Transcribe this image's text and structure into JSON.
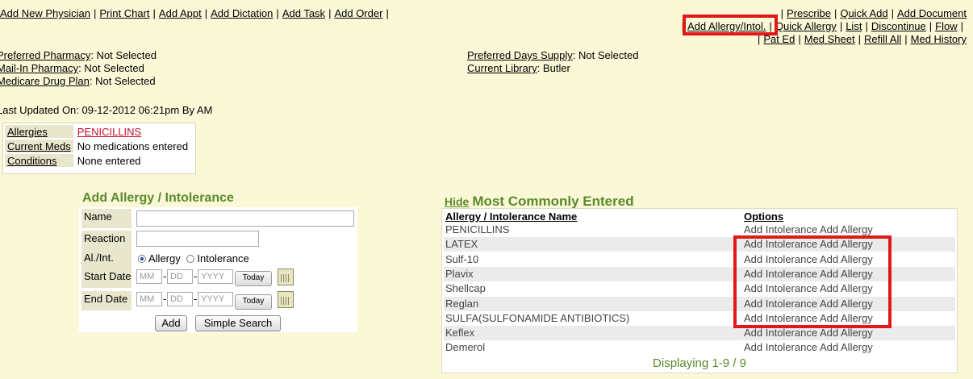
{
  "top_links_left": [
    "Add New Physician",
    "Print Chart",
    "Add Appt",
    "Add Dictation",
    "Add Task",
    "Add Order"
  ],
  "top_links_right": {
    "row1": [
      "Prescribe",
      "Quick Add",
      "Add Document"
    ],
    "row2": [
      "Add Allergy/Intol.",
      "Quick Allergy",
      "List",
      "Discontinue",
      "Flow"
    ],
    "row3": [
      "Pat Ed",
      "Med Sheet",
      "Refill All",
      "Med History"
    ]
  },
  "info": {
    "preferred_pharmacy": {
      "label": "Preferred Pharmacy",
      "value": ": Not Selected"
    },
    "mail_in_pharmacy": {
      "label": "Mail-In Pharmacy",
      "value": ": Not Selected"
    },
    "medicare_drug_plan": {
      "label": "Medicare Drug Plan",
      "value": ": Not Selected"
    },
    "preferred_days_supply": {
      "label": "Preferred Days Supply",
      "value": ": Not Selected"
    },
    "current_library": {
      "label": "Current Library",
      "value": ": Butler"
    },
    "last_updated": "Last Updated On: 09-12-2012 06:21pm By AM"
  },
  "summary": {
    "allergies_label": "Allergies",
    "allergies_value": "PENICILLINS",
    "meds_label": "Current Meds",
    "meds_value": "No medications entered",
    "conditions_label": "Conditions",
    "conditions_value": "None entered"
  },
  "add_form": {
    "title": "Add Allergy / Intolerance",
    "name_label": "Name",
    "reaction_label": "Reaction",
    "type_label": "Al./Int.",
    "radio_allergy": "Allergy",
    "radio_intolerance": "Intolerance",
    "start_label": "Start Date",
    "end_label": "End Date",
    "mm": "MM",
    "dd": "DD",
    "yyyy": "YYYY",
    "today": "Today",
    "add_button": "Add",
    "search_button": "Simple Search"
  },
  "most_common": {
    "hide": "Hide",
    "title": "Most Commonly Entered",
    "col_name": "Allergy / Intolerance Name",
    "col_options": "Options",
    "option_intolerance": "Add Intolerance",
    "option_allergy": "Add Allergy",
    "rows": [
      "PENICILLINS",
      "LATEX",
      "Sulf-10",
      "Plavix",
      "Shellcap",
      "Reglan",
      "SULFA(SULFONAMIDE ANTIBIOTICS)",
      "Keflex",
      "Demerol"
    ],
    "footer": "Displaying 1-9 / 9"
  },
  "colors": {
    "background": "#fbf8d8",
    "accent_green": "#5a8a2a",
    "highlight_red": "#e01818",
    "allergy_red": "#c8102e"
  }
}
